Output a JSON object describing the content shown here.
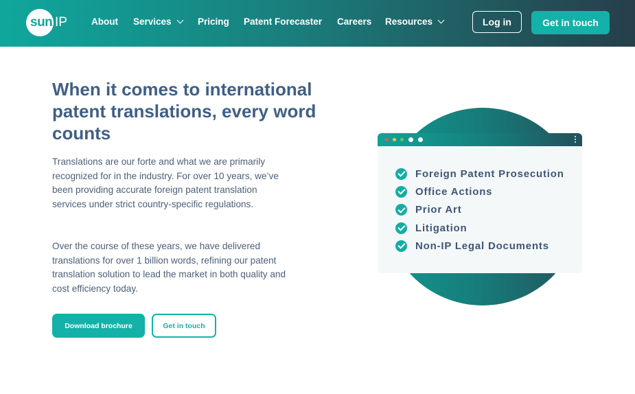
{
  "header": {
    "logo": {
      "sun": "sun",
      "ip": "IP"
    },
    "nav": [
      {
        "label": "About",
        "has_dropdown": false
      },
      {
        "label": "Services",
        "has_dropdown": true
      },
      {
        "label": "Pricing",
        "has_dropdown": false
      },
      {
        "label": "Patent Forecaster",
        "has_dropdown": false
      },
      {
        "label": "Careers",
        "has_dropdown": false
      },
      {
        "label": "Resources",
        "has_dropdown": true
      }
    ],
    "login_label": "Log in",
    "cta_label": "Get in touch"
  },
  "hero": {
    "headline": "When it comes to international patent translations, every word counts",
    "paragraphs": [
      "Translations are our forte and what we are primarily recognized for in the industry. For over 10 years, we’ve been providing accurate foreign patent translation services under strict country-specific regulations.",
      "Over the course of these years, we have delivered translations for over 1 billion words, refining our patent translation solution to lead the market in both quality and cost efficiency today."
    ],
    "download_label": "Download brochure",
    "contact_label": "Get in touch"
  },
  "illustration": {
    "window_dots": [
      "#e0564f",
      "#f0c241",
      "#5ec95e",
      "#ffffff",
      "#ffffff"
    ],
    "services": [
      "Foreign Patent Prosecution",
      "Office Actions",
      "Prior Art",
      "Litigation",
      "Non-IP Legal Documents"
    ]
  },
  "colors": {
    "accent": "#14b1a8",
    "heading": "#3f5f86",
    "body_text": "#4c6078"
  }
}
